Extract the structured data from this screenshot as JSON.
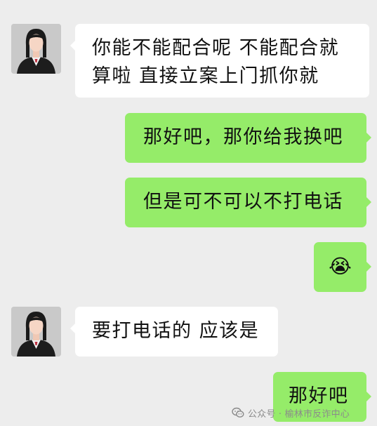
{
  "messages": [
    {
      "id": "m1",
      "side": "left",
      "text": "你能不能配合呢 不能配合就算啦 直接立案上门抓你就"
    },
    {
      "id": "m2",
      "side": "right",
      "text": "那好吧，那你给我换吧"
    },
    {
      "id": "m3",
      "side": "right",
      "text": "但是可不可以不打电话"
    },
    {
      "id": "m4",
      "side": "right",
      "emoji": "😭"
    },
    {
      "id": "m5",
      "side": "left",
      "text": "要打电话的 应该是"
    },
    {
      "id": "m6",
      "side": "right",
      "text": "那好吧"
    }
  ],
  "watermark": {
    "text": "公众号 · 榆林市反诈中心",
    "icon": "wechat-icon"
  },
  "colors": {
    "background": "#ededed",
    "bubble_self": "#95ec69",
    "bubble_other": "#ffffff"
  }
}
